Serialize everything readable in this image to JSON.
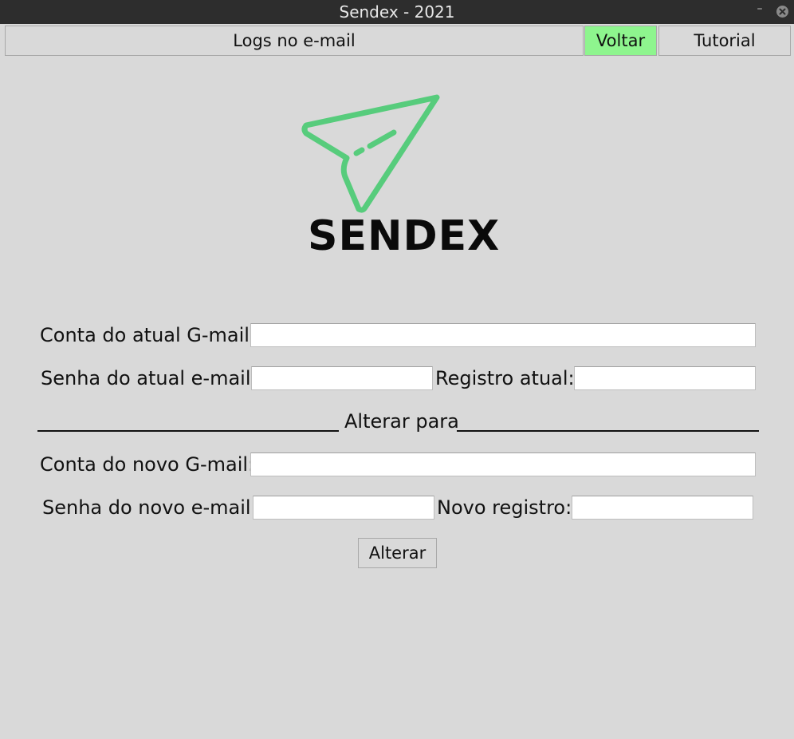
{
  "window": {
    "title": "Sendex - 2021",
    "minimize_glyph": "–"
  },
  "toolbar": {
    "logs_label": "Logs no e-mail",
    "back_label": "Voltar",
    "tutorial_label": "Tutorial",
    "back_color": "#8ef58e"
  },
  "logo": {
    "text": "SENDEX",
    "icon": "paper-plane-icon",
    "accent": "#57cc7c"
  },
  "form": {
    "current_account_label": "Conta do atual G-mail:",
    "current_account_value": "",
    "current_password_label": "Senha do atual e-mail:",
    "current_password_value": "",
    "current_registry_label": "Registro atual:",
    "current_registry_value": "",
    "divider_label": "Alterar para",
    "new_account_label": "Conta do novo G-mail:",
    "new_account_value": "",
    "new_password_label": "Senha do novo e-mail:",
    "new_password_value": "",
    "new_registry_label": "Novo registro:",
    "new_registry_value": "",
    "submit_label": "Alterar"
  }
}
